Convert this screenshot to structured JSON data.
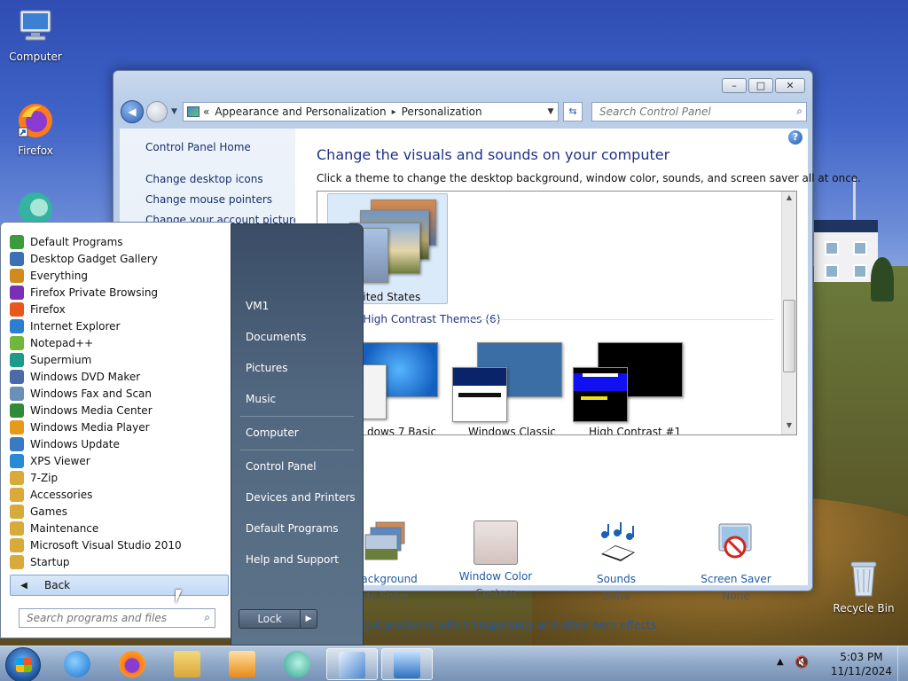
{
  "desktop": {
    "icons": [
      {
        "label": "Computer",
        "icon": "computer-icon"
      },
      {
        "label": "Firefox",
        "icon": "firefox-icon"
      },
      {
        "label": "Recycle Bin",
        "icon": "recycle-bin-icon"
      }
    ]
  },
  "window": {
    "caption_buttons": {
      "minimize": "–",
      "maximize": "□",
      "close": "✕"
    },
    "address": {
      "prefix": "«",
      "crumbs": [
        "Appearance and Personalization",
        "Personalization"
      ],
      "separator": "▸"
    },
    "search": {
      "placeholder": "Search Control Panel"
    },
    "left_pane": {
      "links": [
        "Control Panel Home",
        "Change desktop icons",
        "Change mouse pointers",
        "Change your account picture"
      ]
    },
    "content": {
      "title": "Change the visuals and sounds on your computer",
      "subtitle": "Click a theme to change the desktop background, window color, sounds, and screen saver all at once.",
      "selected_theme": "nited States",
      "group_title": "d High Contrast Themes (6)",
      "theme_captions": [
        "dows 7 Basic",
        "Windows Classic",
        "High Contrast #1"
      ],
      "settings": [
        {
          "label": "Background",
          "value": "de Show",
          "icon": "desktop-background-icon"
        },
        {
          "label": "Window Color",
          "value": "Custom",
          "icon": "window-color-icon"
        },
        {
          "label": "Sounds",
          "value": "Delta",
          "icon": "sounds-icon"
        },
        {
          "label": "Screen Saver",
          "value": "None",
          "icon": "screen-saver-icon"
        }
      ],
      "troubleshoot": "ubleshoot problems with transparency and other Aero effects"
    }
  },
  "start_menu": {
    "programs": [
      {
        "label": "Default Programs",
        "color": "#3d9a3d"
      },
      {
        "label": "Desktop Gadget Gallery",
        "color": "#3b6fb6"
      },
      {
        "label": "Everything",
        "color": "#d08b1d"
      },
      {
        "label": "Firefox Private Browsing",
        "color": "#7a2fb5"
      },
      {
        "label": "Firefox",
        "color": "#e8571c"
      },
      {
        "label": "Internet Explorer",
        "color": "#2c7fd0"
      },
      {
        "label": "Notepad++",
        "color": "#6fb83b"
      },
      {
        "label": "Supermium",
        "color": "#1e9a8a"
      },
      {
        "label": "Windows DVD Maker",
        "color": "#4a6aa8"
      },
      {
        "label": "Windows Fax and Scan",
        "color": "#6a8fb8"
      },
      {
        "label": "Windows Media Center",
        "color": "#2f8a3a"
      },
      {
        "label": "Windows Media Player",
        "color": "#e69a1c"
      },
      {
        "label": "Windows Update",
        "color": "#3a7ac2"
      },
      {
        "label": "XPS Viewer",
        "color": "#2a89d4"
      },
      {
        "label": "7-Zip",
        "color": "#d9a93a"
      },
      {
        "label": "Accessories",
        "color": "#d9a93a"
      },
      {
        "label": "Games",
        "color": "#d9a93a"
      },
      {
        "label": "Maintenance",
        "color": "#d9a93a"
      },
      {
        "label": "Microsoft Visual Studio 2010",
        "color": "#d9a93a"
      },
      {
        "label": "Startup",
        "color": "#d9a93a"
      }
    ],
    "back_label": "Back",
    "search_placeholder": "Search programs and files",
    "right_links": [
      "VM1",
      "Documents",
      "Pictures",
      "Music",
      "Computer",
      "Control Panel",
      "Devices and Printers",
      "Default Programs",
      "Help and Support"
    ],
    "lock_label": "Lock",
    "lock_arrow": "▶"
  },
  "taskbar": {
    "items": [
      "internet-explorer-icon",
      "firefox-icon",
      "file-explorer-icon",
      "media-player-icon",
      "supermium-icon",
      "control-panel-icon",
      "remote-desktop-icon"
    ],
    "time": "5:03 PM",
    "date": "11/11/2024",
    "tray_arrow": "▲",
    "volume_symbol": "🔇"
  }
}
